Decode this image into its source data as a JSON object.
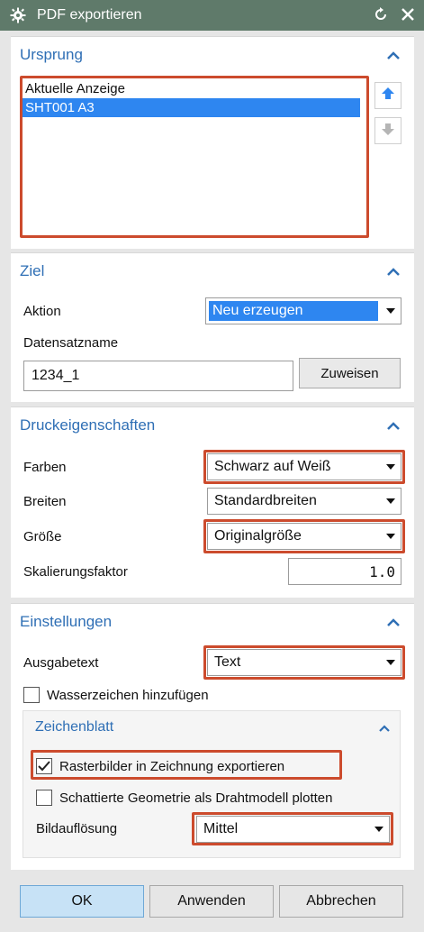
{
  "window": {
    "title": "PDF exportieren"
  },
  "icons": {
    "gear": "gear-icon",
    "reset": "reset-icon",
    "close": "close-icon",
    "collapse": "chevron-up-icon",
    "move_up": "arrow-up-icon",
    "move_down": "arrow-down-icon",
    "dropdown": "triangle-down-icon",
    "check": "check-icon"
  },
  "colors": {
    "titlebar": "#5f7a6a",
    "section_title": "#2f6fb5",
    "selection": "#2e86f0",
    "highlight": "#cc4b2d",
    "primary_button": "#c7e2f6"
  },
  "ursprung": {
    "title": "Ursprung",
    "items": [
      "Aktuelle Anzeige",
      "SHT001  A3"
    ],
    "selected_index": 1
  },
  "ziel": {
    "title": "Ziel",
    "aktion_label": "Aktion",
    "aktion_value": "Neu erzeugen",
    "datensatzname_label": "Datensatzname",
    "datensatzname_value": "1234_1",
    "zuweisen_label": "Zuweisen"
  },
  "druck": {
    "title": "Druckeigenschaften",
    "farben_label": "Farben",
    "farben_value": "Schwarz auf Weiß",
    "breiten_label": "Breiten",
    "breiten_value": "Standardbreiten",
    "groesse_label": "Größe",
    "groesse_value": "Originalgröße",
    "skalierung_label": "Skalierungsfaktor",
    "skalierung_value": "1.0"
  },
  "einstellungen": {
    "title": "Einstellungen",
    "ausgabetext_label": "Ausgabetext",
    "ausgabetext_value": "Text",
    "wasserzeichen_label": "Wasserzeichen hinzufügen",
    "wasserzeichen_checked": false,
    "zeichenblatt": {
      "title": "Zeichenblatt",
      "raster_label": "Rasterbilder in Zeichnung exportieren",
      "raster_checked": true,
      "schattiert_label": "Schattierte Geometrie als Drahtmodell plotten",
      "schattiert_checked": false,
      "bildaufloesung_label": "Bildauflösung",
      "bildaufloesung_value": "Mittel"
    }
  },
  "footer": {
    "ok": "OK",
    "anwenden": "Anwenden",
    "abbrechen": "Abbrechen"
  }
}
